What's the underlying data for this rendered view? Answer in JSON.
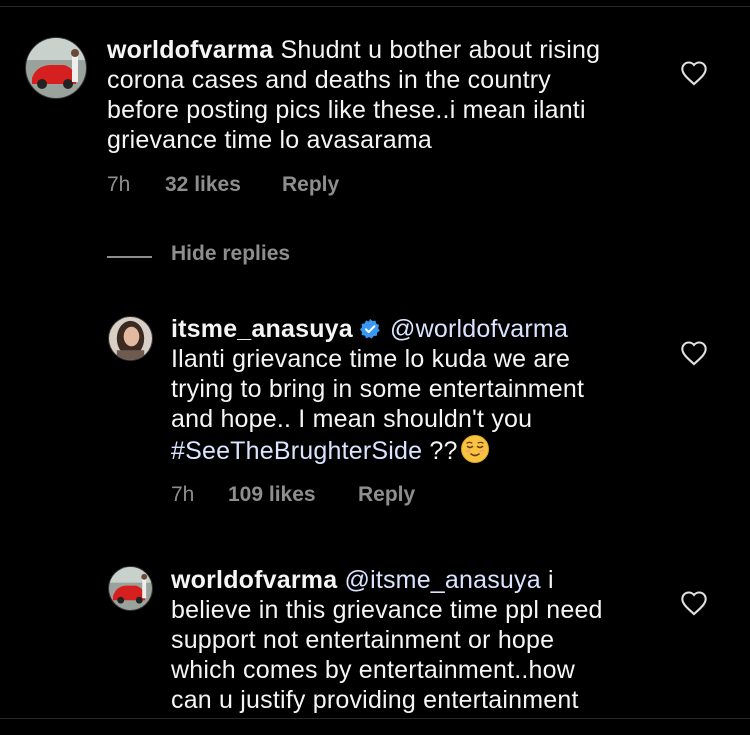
{
  "comments": [
    {
      "username": "worldofvarma",
      "lines": [
        "Shudnt u bother about rising",
        "corona cases and deaths in the country",
        "before posting pics like these..i mean ilanti",
        "grievance time lo avasarama"
      ],
      "time": "7h",
      "likes": "32 likes",
      "reply": "Reply"
    },
    {
      "username": "itsme_anasuya",
      "verified": true,
      "mention": "@worldofvarma",
      "lines": [
        "Ilanti grievance time lo kuda we are",
        "trying to bring in some entertainment",
        "and hope.. I mean shouldn't you"
      ],
      "hashtag": "#SeeTheBrughterSide",
      "tail": " ??",
      "emoji": "relieved-face-emoji",
      "time": "7h",
      "likes": "109 likes",
      "reply": "Reply"
    },
    {
      "username": "worldofvarma",
      "mention": "@itsme_anasuya",
      "first_line_tail": " i",
      "lines": [
        "believe in this grievance time ppl need",
        "support not entertainment or hope",
        "which comes by entertainment..how",
        "can u justify providing entertainment"
      ]
    }
  ],
  "hide_replies": "Hide replies",
  "icons": {
    "like": "heart-outline-icon",
    "verified": "verified-badge-icon"
  },
  "colors": {
    "background": "#000000",
    "text": "#f5f5f5",
    "muted": "#8e8e8e",
    "verified": "#3897f0"
  }
}
